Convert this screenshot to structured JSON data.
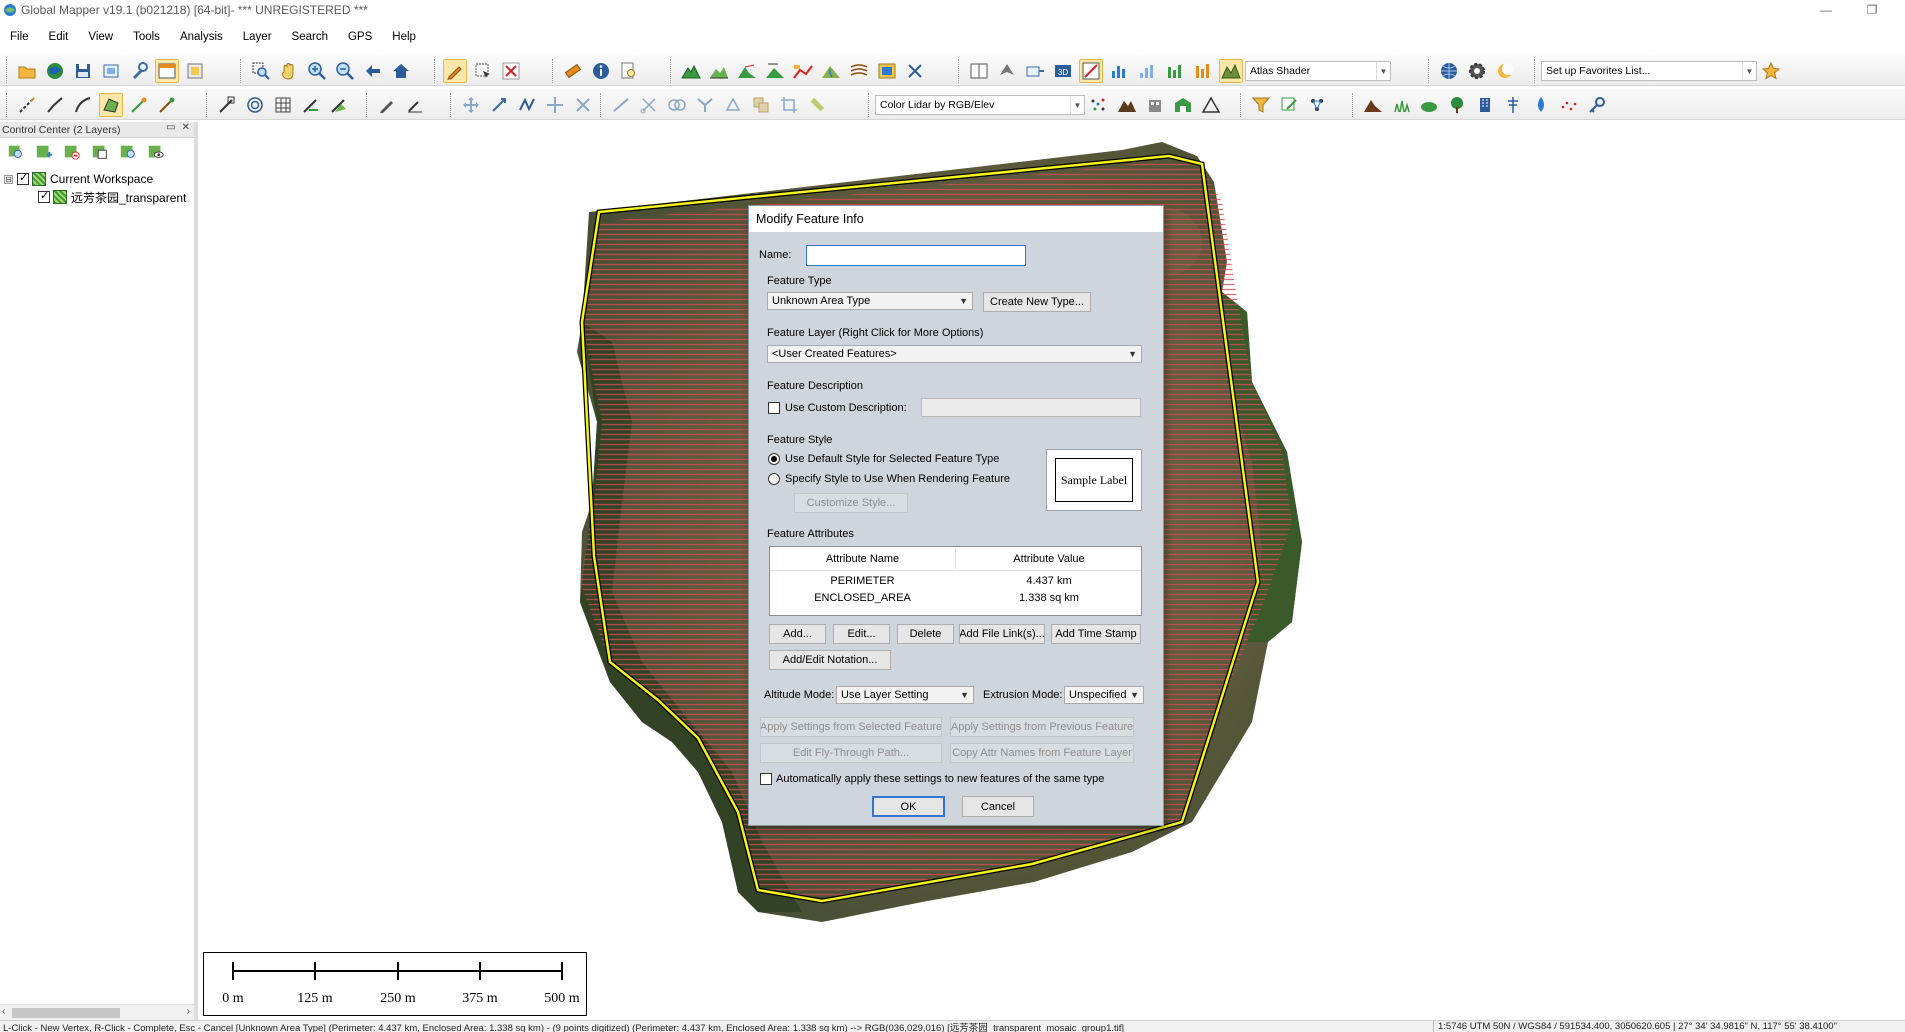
{
  "window": {
    "title": "Global Mapper v19.1 (b021218) [64-bit]- *** UNREGISTERED ***",
    "minimize": "—",
    "restore": "❐"
  },
  "menu": [
    "File",
    "Edit",
    "View",
    "Tools",
    "Analysis",
    "Layer",
    "Search",
    "GPS",
    "Help"
  ],
  "toolbar": {
    "shader_combo": "Atlas Shader",
    "favorites_combo": "Set up Favorites List...",
    "lidar_combo": "Color Lidar by RGB/Elev"
  },
  "control_center": {
    "title": "Control Center (2 Layers)",
    "workspace_label": "Current Workspace",
    "layer_label": "远芳茶园_transparent",
    "collapse_glyph": "⊟"
  },
  "scale_bar": {
    "labels": [
      "0 m",
      "125 m",
      "250 m",
      "375 m",
      "500 m"
    ]
  },
  "status": {
    "message": "L-Click - New Vertex, R-Click - Complete, Esc - Cancel [Unknown Area Type] (Perimeter: 4.437 km, Enclosed Area: 1.338 sq km) - (9 points digitized) (Perimeter: 4.437 km, Enclosed Area: 1.338 sq km) --> RGB(036,029,016) [远芳茶园_transparent_mosaic_group1.tif]",
    "coords": "1:5746   UTM 50N / WGS84 / 591534.400, 3050620.605 | 27° 34' 34.9816\" N, 117° 55' 38.4100\""
  },
  "dialog": {
    "title": "Modify Feature Info",
    "name_label": "Name:",
    "name_value": "",
    "feature_type_label": "Feature Type",
    "feature_type_value": "Unknown Area Type",
    "create_new_type": "Create New Type...",
    "feature_layer_label": "Feature Layer (Right Click for More Options)",
    "feature_layer_value": "<User Created Features>",
    "feature_description_label": "Feature Description",
    "use_custom_description": "Use Custom Description:",
    "feature_style_label": "Feature Style",
    "use_default_style": "Use Default Style for Selected Feature Type",
    "specify_style": "Specify Style to Use When Rendering Feature",
    "customize_style": "Customize Style...",
    "sample_label": "Sample Label",
    "feature_attributes_label": "Feature Attributes",
    "attr_col_name": "Attribute Name",
    "attr_col_value": "Attribute Value",
    "attributes": [
      {
        "name": "PERIMETER",
        "value": "4.437 km"
      },
      {
        "name": "ENCLOSED_AREA",
        "value": "1.338 sq km"
      }
    ],
    "add": "Add...",
    "edit": "Edit...",
    "delete": "Delete",
    "add_file_links": "Add File Link(s)...",
    "add_time_stamp": "Add Time Stamp",
    "add_edit_notation": "Add/Edit Notation...",
    "altitude_mode_label": "Altitude Mode:",
    "altitude_mode_value": "Use Layer Setting",
    "extrusion_mode_label": "Extrusion Mode:",
    "extrusion_mode_value": "Unspecified",
    "apply_from_selected": "Apply Settings from Selected Feature",
    "apply_from_previous": "Apply Settings from Previous Feature",
    "edit_fly_through": "Edit Fly-Through Path...",
    "copy_attr_names": "Copy Attr Names from Feature Layer",
    "auto_apply": "Automatically apply these settings to new features of the same type",
    "ok": "OK",
    "cancel": "Cancel"
  }
}
